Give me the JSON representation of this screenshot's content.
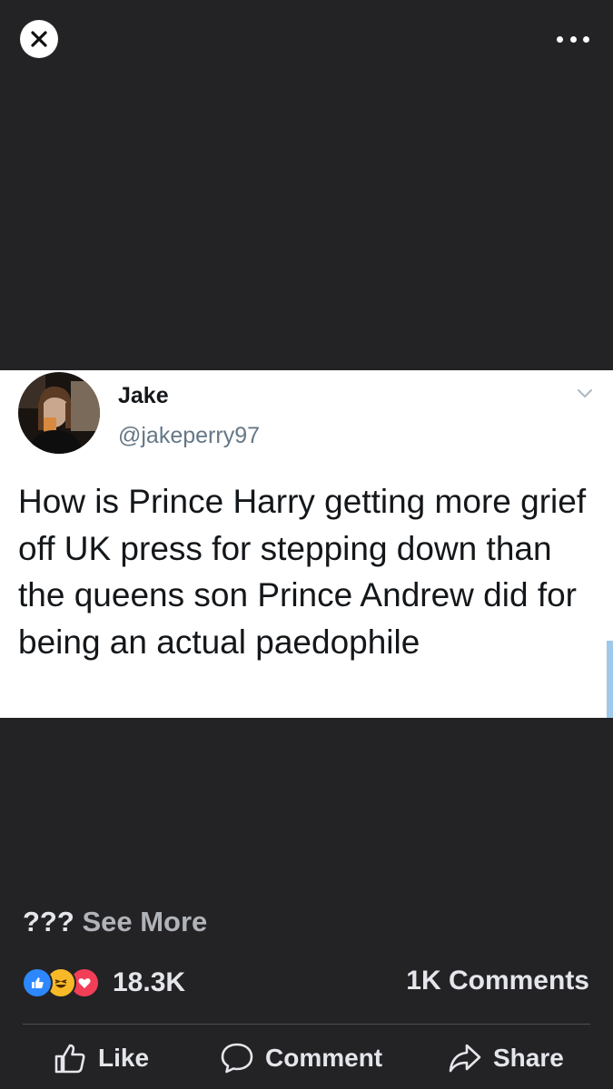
{
  "toolbar": {
    "close_icon": "close-icon",
    "more_icon": "more-dots-icon"
  },
  "tweet": {
    "author_name": "Jake",
    "author_handle": "@jakeperry97",
    "text": "How is Prince Harry getting more grief off UK press for stepping down than the queens son Prince Andrew did for being an actual paedophile"
  },
  "post": {
    "caption": "???",
    "see_more": "See More",
    "reaction_count": "18.3K",
    "comments_count": "1K Comments",
    "reaction_icons": [
      "like-reaction-icon",
      "haha-reaction-icon",
      "love-reaction-icon"
    ]
  },
  "actions": {
    "like": "Like",
    "comment": "Comment",
    "share": "Share"
  },
  "colors": {
    "background": "#232325",
    "like_blue": "#2d88ff",
    "love_red": "#f33e58",
    "haha_yellow": "#f7b928",
    "handle_gray": "#657786"
  }
}
